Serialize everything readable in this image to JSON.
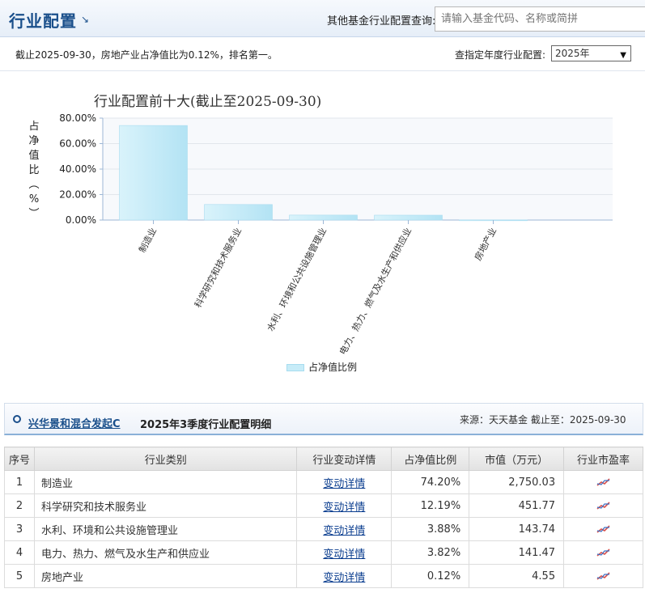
{
  "header": {
    "title": "行业配置",
    "title_icon": "arrow-down-right-icon",
    "query_label": "其他基金行业配置查询:",
    "search_placeholder": "请输入基金代码、名称或简拼"
  },
  "summary": {
    "text": "截止2025-09-30，房地产业占净值比为0.12%，排名第一。",
    "year_label": "查指定年度行业配置:",
    "year_value": "2025年"
  },
  "chart_data": {
    "type": "bar",
    "title": "行业配置前十大(截止至2025-09-30)",
    "ylabel": "占净值比(%)",
    "categories": [
      "制造业",
      "科学研究和技术服务业",
      "水利、环境和公共设施管理业",
      "电力、热力、燃气及水生产和供应业",
      "房地产业"
    ],
    "values": [
      74.2,
      12.19,
      3.88,
      3.82,
      0.12
    ],
    "yticks": [
      "80.00%",
      "60.00%",
      "40.00%",
      "20.00%",
      "0.00%"
    ],
    "ylim": [
      0,
      80
    ],
    "series": [
      {
        "name": "占净值比例",
        "values": [
          74.2,
          12.19,
          3.88,
          3.82,
          0.12
        ]
      }
    ],
    "grid": true,
    "legend_position": "bottom-center",
    "bar_color": "#bfe8f6"
  },
  "detail": {
    "fund_name": "兴华景和混合发起C",
    "title": "2025年3季度行业配置明细",
    "source": "来源：天天基金   截止至：2025-09-30"
  },
  "table": {
    "headers": [
      "序号",
      "行业类别",
      "行业变动详情",
      "占净值比例",
      "市值（万元）",
      "行业市盈率"
    ],
    "rows": [
      [
        "1",
        "制造业",
        "变动详情",
        "74.20%",
        "2,750.03"
      ],
      [
        "2",
        "科学研究和技术服务业",
        "变动详情",
        "12.19%",
        "451.77"
      ],
      [
        "3",
        "水利、环境和公共设施管理业",
        "变动详情",
        "3.88%",
        "143.74"
      ],
      [
        "4",
        "电力、热力、燃气及水生产和供应业",
        "变动详情",
        "3.82%",
        "141.47"
      ],
      [
        "5",
        "房地产业",
        "变动详情",
        "0.12%",
        "4.55"
      ]
    ],
    "pe_icon": "trend-line-icon"
  }
}
